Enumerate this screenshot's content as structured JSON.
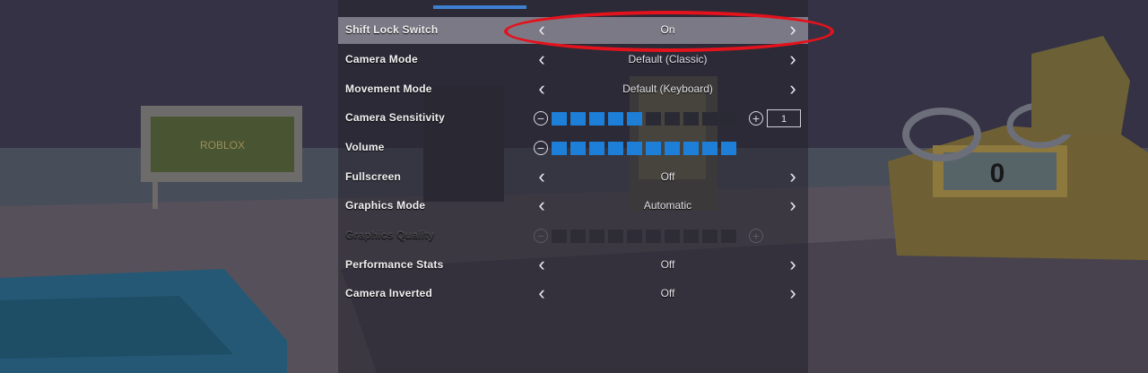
{
  "settings": {
    "rows": [
      {
        "label": "Shift Lock Switch",
        "value": "On"
      },
      {
        "label": "Camera Mode",
        "value": "Default (Classic)"
      },
      {
        "label": "Movement Mode",
        "value": "Default (Keyboard)"
      },
      {
        "label": "Camera Sensitivity",
        "value": "1",
        "level": 0.5
      },
      {
        "label": "Volume",
        "level": 1.0
      },
      {
        "label": "Fullscreen",
        "value": "Off"
      },
      {
        "label": "Graphics Mode",
        "value": "Automatic"
      },
      {
        "label": "Graphics Quality",
        "level": 0.0
      },
      {
        "label": "Performance Stats",
        "value": "Off"
      },
      {
        "label": "Camera Inverted",
        "value": "Off"
      }
    ]
  },
  "scene": {
    "scoreboard_value": "0",
    "sign_text": "ROBLOX"
  },
  "colors": {
    "accent": "#1e7fd8",
    "annotation": "#e4121c",
    "highlight_row": "#96949f"
  },
  "icons": {
    "left_arrow": "chevron-left-icon",
    "right_arrow": "chevron-right-icon",
    "minus": "minus-circle-icon",
    "plus": "plus-circle-icon"
  }
}
